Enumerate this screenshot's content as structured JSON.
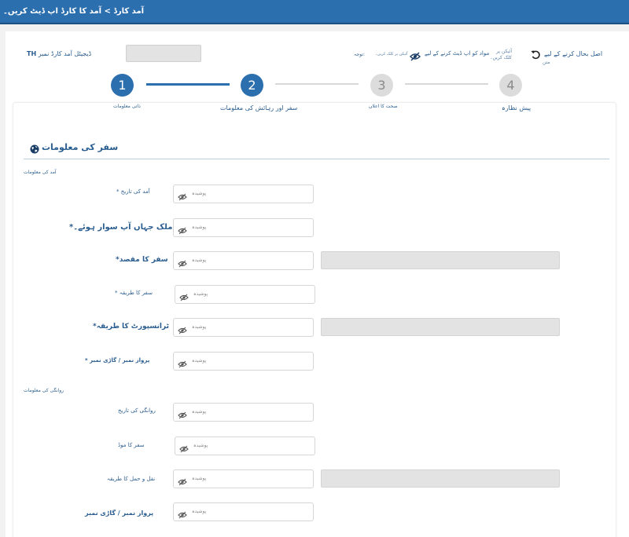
{
  "breadcrumb": "آمد کارڈ > آمد کا کارڈ اپ ڈیٹ کریں۔",
  "header": {
    "title_code": "TH",
    "title_text": "ڈیجیٹل آمد کارڈ نمبر",
    "update_content_label": "مواد کو اپ ڈیٹ کرنے کے لیے",
    "update_content_hint": "آئیکن پر کلک کریں۔",
    "note_label": "توجہ:",
    "click_icon_line1": "آئیکن پر",
    "click_icon_line2": "کلک کریں۔",
    "restore_label": "اصل بحال کرنے کے لیے",
    "restore_sub": "متن"
  },
  "steps": [
    {
      "number": "1",
      "label": "ذاتی معلومات",
      "state": "active"
    },
    {
      "number": "2",
      "label": "سفر اور رہائش کی معلومات",
      "state": "active"
    },
    {
      "number": "3",
      "label": "صحت کا اعلان",
      "state": "inactive"
    },
    {
      "number": "4",
      "label": "پیش نظارہ",
      "state": "inactive"
    }
  ],
  "section": {
    "title": "سفر کی معلومات",
    "arrival_subheading": "آمد کی معلومات",
    "departure_subheading": "روانگی کی معلومات"
  },
  "placeholder": "پوشیدہ",
  "arrival_fields": [
    {
      "label": "* آمد کی تاریخ"
    },
    {
      "label": "*وہ ملک جہاں آپ سوار ہوئے۔"
    },
    {
      "label": "*سفر کا مقصد"
    },
    {
      "label": "* سفر کا طریقہ"
    },
    {
      "label": "*ٹرانسپورٹ کا طریقہ"
    },
    {
      "label": "* پرواز نمبر / گاڑی نمبر"
    }
  ],
  "departure_fields": [
    {
      "label": "روانگی کی تاریخ"
    },
    {
      "label": "سفر کا موڈ"
    },
    {
      "label": "نقل و حمل کا طریقہ"
    },
    {
      "label": "پرواز نمبر / گاڑی نمبر"
    }
  ],
  "colors": {
    "primary": "#2c6fae",
    "inactive_step": "#dcdcdc"
  }
}
